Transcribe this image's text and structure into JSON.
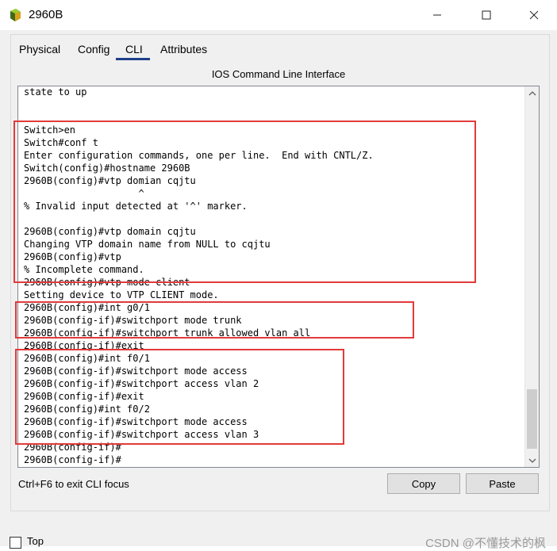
{
  "window": {
    "title": "2960B",
    "minimize_icon": "minimize-icon",
    "maximize_icon": "maximize-icon",
    "close_icon": "close-icon"
  },
  "tabs": [
    {
      "label": "Physical"
    },
    {
      "label": "Config"
    },
    {
      "label": "CLI"
    },
    {
      "label": "Attributes"
    }
  ],
  "active_tab": "CLI",
  "cli": {
    "title": "IOS Command Line Interface",
    "lines": [
      "state to up",
      "",
      "",
      "Switch>en",
      "Switch#conf t",
      "Enter configuration commands, one per line.  End with CNTL/Z.",
      "Switch(config)#hostname 2960B",
      "2960B(config)#vtp domian cqjtu",
      "                    ^",
      "% Invalid input detected at '^' marker.",
      "",
      "2960B(config)#vtp domain cqjtu",
      "Changing VTP domain name from NULL to cqjtu",
      "2960B(config)#vtp",
      "% Incomplete command.",
      "2960B(config)#vtp mode client",
      "Setting device to VTP CLIENT mode.",
      "2960B(config)#int g0/1",
      "2960B(config-if)#switchport mode trunk",
      "2960B(config-if)#switchport trunk allowed vlan all",
      "2960B(config-if)#exit",
      "2960B(config)#int f0/1",
      "2960B(config-if)#switchport mode access",
      "2960B(config-if)#switchport access vlan 2",
      "2960B(config-if)#exit",
      "2960B(config)#int f0/2",
      "2960B(config-if)#switchport mode access",
      "2960B(config-if)#switchport access vlan 3",
      "2960B(config-if)#",
      "2960B(config-if)#"
    ],
    "scroll_up_icon": "chevron-up-icon",
    "scroll_down_icon": "chevron-down-icon",
    "highlight_color": "#e23a3a"
  },
  "footer": {
    "hint": "Ctrl+F6 to exit CLI focus",
    "copy_label": "Copy",
    "paste_label": "Paste"
  },
  "bottom": {
    "top_label": "Top",
    "top_checked": false,
    "watermark": "CSDN @不懂技术的枫"
  }
}
